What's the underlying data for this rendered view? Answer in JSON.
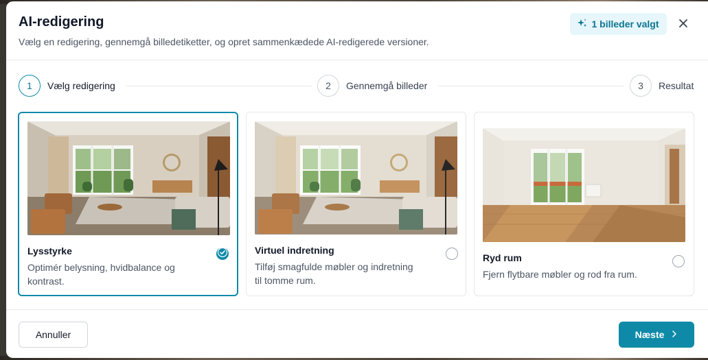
{
  "modal": {
    "title": "AI-redigering",
    "subtitle": "Vælg en redigering, gennemgå billedetiketter, og opret sammenkædede AI-redigerede versioner.",
    "selected_badge": "1 billeder valgt",
    "selected_icon": "sparkles-icon",
    "close_icon": "close-icon"
  },
  "steps": [
    {
      "number": "1",
      "label": "Vælg redigering",
      "state": "active"
    },
    {
      "number": "2",
      "label": "Gennemgå billeder",
      "state": "inactive"
    },
    {
      "number": "3",
      "label": "Resultat",
      "state": "inactive"
    }
  ],
  "options": [
    {
      "title": "Lysstyrke",
      "description": "Optimér belysning, hvidbalance og kontrast.",
      "selected": true,
      "image": "furnished-living-room-photo"
    },
    {
      "title": "Virtuel indretning",
      "description": "Tilføj smagfulde møbler og indretning til tomme rum.",
      "selected": false,
      "image": "furnished-living-room-photo"
    },
    {
      "title": "Ryd rum",
      "description": "Fjern flytbare møbler og rod fra rum.",
      "selected": false,
      "image": "empty-room-photo"
    }
  ],
  "footer": {
    "cancel_label": "Annuller",
    "next_label": "Næste",
    "next_icon": "chevron-right-icon"
  },
  "colors": {
    "accent": "#0e8aa8",
    "badge_bg": "#e6f6fa",
    "badge_text": "#0e7490"
  }
}
